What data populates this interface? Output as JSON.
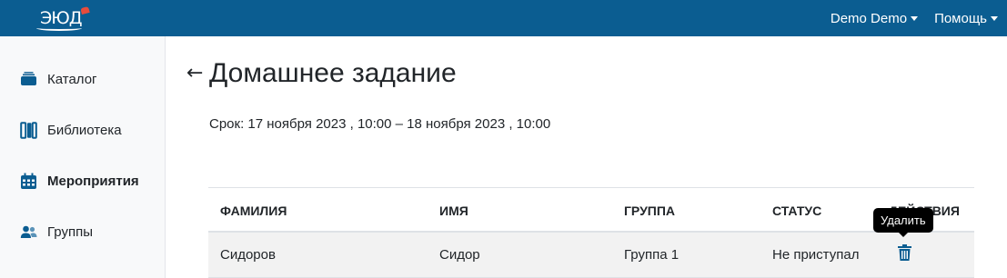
{
  "header": {
    "logo_text": "ЭЮД",
    "user_menu": "Demo Demo",
    "help_menu": "Помощь"
  },
  "sidebar": {
    "items": [
      {
        "label": "Каталог",
        "icon": "catalog-icon"
      },
      {
        "label": "Библиотека",
        "icon": "library-icon"
      },
      {
        "label": "Мероприятия",
        "icon": "calendar-icon",
        "active": true
      },
      {
        "label": "Группы",
        "icon": "users-icon"
      }
    ]
  },
  "main": {
    "title": "Домашнее задание",
    "deadline": "Срок: 17 ноября 2023 , 10:00 – 18 ноября 2023 , 10:00"
  },
  "table": {
    "headers": [
      "Фамилия",
      "Имя",
      "Группа",
      "Статус",
      "Действия"
    ],
    "rows": [
      {
        "last_name": "Сидоров",
        "first_name": "Сидор",
        "group": "Группа 1",
        "status": "Не приступал"
      }
    ]
  },
  "tooltip": "Удалить",
  "colors": {
    "brand": "#0b5d91",
    "icon": "#0b5d91"
  }
}
